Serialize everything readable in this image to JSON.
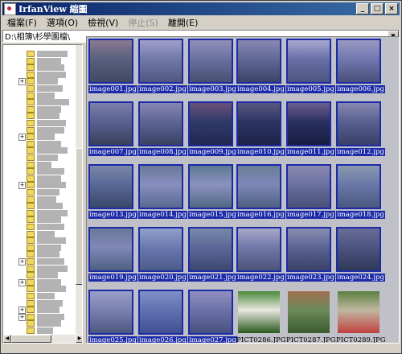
{
  "window": {
    "title": "IrfanView 縮圖"
  },
  "title_buttons": {
    "min": "_",
    "max": "□",
    "close": "×"
  },
  "menu": [
    {
      "label": "檔案(F)",
      "enabled": true
    },
    {
      "label": "選項(O)",
      "enabled": true
    },
    {
      "label": "檢視(V)",
      "enabled": true
    },
    {
      "label": "停止(S)",
      "enabled": false
    },
    {
      "label": "離開(E)",
      "enabled": true
    }
  ],
  "path": {
    "value": "D:\\相簿\\杉學園檔\\"
  },
  "tree": {
    "selected_label": "杉學園檔",
    "expander_rows": [
      4,
      12,
      19,
      30,
      33,
      37,
      38,
      41
    ]
  },
  "thumbnails": [
    {
      "name": "image001.jpg",
      "selected": true,
      "colors": [
        "#5a6080",
        "#8a7a90",
        "#404a60"
      ]
    },
    {
      "name": "image002.jpg",
      "selected": true,
      "colors": [
        "#7078a8",
        "#a0a0c8",
        "#505880"
      ]
    },
    {
      "name": "image003.jpg",
      "selected": true,
      "colors": [
        "#6a70a0",
        "#9090b8",
        "#485070"
      ]
    },
    {
      "name": "image004.jpg",
      "selected": true,
      "colors": [
        "#606898",
        "#8a88b0",
        "#3c4468"
      ]
    },
    {
      "name": "image005.jpg",
      "selected": true,
      "colors": [
        "#6870a8",
        "#a8a8d0",
        "#4c5480"
      ]
    },
    {
      "name": "image006.jpg",
      "selected": true,
      "colors": [
        "#7078b0",
        "#9a98c0",
        "#4a5078"
      ]
    },
    {
      "name": "image007.jpg",
      "selected": true,
      "colors": [
        "#5a6090",
        "#7a80a8",
        "#38405c"
      ]
    },
    {
      "name": "image008.jpg",
      "selected": true,
      "colors": [
        "#5c6494",
        "#8888b0",
        "#3a4262"
      ]
    },
    {
      "name": "image009.jpg",
      "selected": true,
      "colors": [
        "#303a6a",
        "#6a5078",
        "#202850"
      ]
    },
    {
      "name": "image010.jpg",
      "selected": true,
      "colors": [
        "#2c3464",
        "#5a5880",
        "#1c2248"
      ]
    },
    {
      "name": "image011.jpg",
      "selected": true,
      "colors": [
        "#2a3060",
        "#6a6090",
        "#181e40"
      ]
    },
    {
      "name": "image012.jpg",
      "selected": true,
      "colors": [
        "#586090",
        "#8888b0",
        "#384068"
      ]
    },
    {
      "name": "image013.jpg",
      "selected": true,
      "colors": [
        "#5a6898",
        "#7a88a8",
        "#3a4868"
      ]
    },
    {
      "name": "image014.jpg",
      "selected": true,
      "colors": [
        "#8890c0",
        "#6a7898",
        "#586890"
      ]
    },
    {
      "name": "image015.jpg",
      "selected": true,
      "colors": [
        "#8a92c0",
        "#5e7890",
        "#506880"
      ]
    },
    {
      "name": "image016.jpg",
      "selected": true,
      "colors": [
        "#7e88b8",
        "#6a7e98",
        "#4e6080"
      ]
    },
    {
      "name": "image017.jpg",
      "selected": true,
      "colors": [
        "#6a70a0",
        "#8a8ab0",
        "#4a5078"
      ]
    },
    {
      "name": "image018.jpg",
      "selected": true,
      "colors": [
        "#6a78a8",
        "#8a98b0",
        "#4a5880"
      ]
    },
    {
      "name": "image019.jpg",
      "selected": true,
      "colors": [
        "#8088b8",
        "#6a7898",
        "#4e6080"
      ]
    },
    {
      "name": "image020.jpg",
      "selected": true,
      "colors": [
        "#6a78b0",
        "#90a0c8",
        "#4c5c88"
      ]
    },
    {
      "name": "image021.jpg",
      "selected": true,
      "colors": [
        "#5c6898",
        "#7888a8",
        "#3c4870"
      ]
    },
    {
      "name": "image022.jpg",
      "selected": true,
      "colors": [
        "#7078a8",
        "#a8a8c8",
        "#4c5478"
      ]
    },
    {
      "name": "image023.jpg",
      "selected": true,
      "colors": [
        "#5a6494",
        "#8a8cb0",
        "#3a4268"
      ]
    },
    {
      "name": "image024.jpg",
      "selected": true,
      "colors": [
        "#4c5480",
        "#6a6e98",
        "#303858"
      ]
    },
    {
      "name": "image025.jpg",
      "selected": true,
      "colors": [
        "#7a80b0",
        "#9aa0c8",
        "#4c5880"
      ]
    },
    {
      "name": "image026.jpg",
      "selected": true,
      "colors": [
        "#6070b0",
        "#8090c8",
        "#405090"
      ]
    },
    {
      "name": "image027.jpg",
      "selected": true,
      "colors": [
        "#6a72a8",
        "#9090c0",
        "#485080"
      ]
    },
    {
      "name": "PICT0286.JPG",
      "selected": false,
      "colors": [
        "#e8e8e0",
        "#4a8a3a",
        "#2a5a20"
      ]
    },
    {
      "name": "PICT0287.JPG",
      "selected": false,
      "colors": [
        "#6a8a5a",
        "#a07050",
        "#3a5a30"
      ]
    },
    {
      "name": "PICT0289.JPG",
      "selected": false,
      "colors": [
        "#c0b8a0",
        "#5a8040",
        "#c04040"
      ]
    }
  ]
}
